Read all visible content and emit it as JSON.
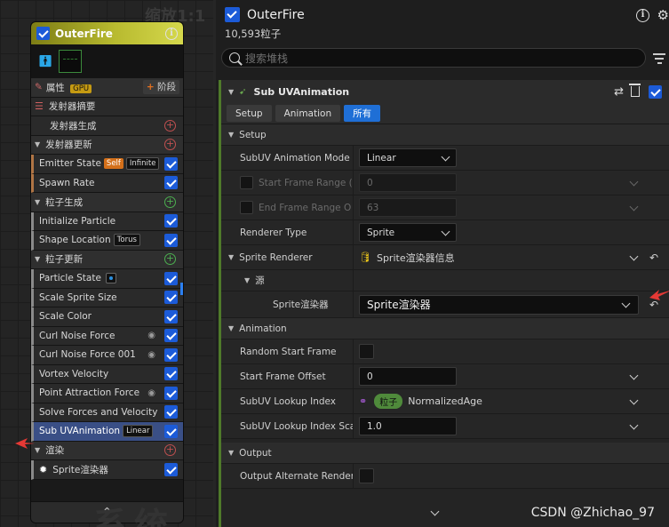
{
  "graph": {
    "zoom_label": "缩放1:1",
    "watermark": "系统"
  },
  "node": {
    "title": "OuterFire",
    "props_label": "属性",
    "gpu_tag": "GPU",
    "stage_label": "阶段",
    "rows": [
      {
        "kind": "plain",
        "label": "发射器摘要",
        "icon": "list-icon"
      },
      {
        "kind": "plain-indent",
        "label": "发射器生成",
        "plus": "red"
      },
      {
        "kind": "section",
        "label": "发射器更新",
        "plus": "red"
      },
      {
        "kind": "module",
        "label": "Emitter State",
        "tags": [
          "Self",
          "Infinite"
        ],
        "checked": true,
        "border": "orange"
      },
      {
        "kind": "module",
        "label": "Spawn Rate",
        "checked": true,
        "border": "orange"
      },
      {
        "kind": "section",
        "label": "粒子生成",
        "plus": "green"
      },
      {
        "kind": "module",
        "label": "Initialize Particle",
        "checked": true
      },
      {
        "kind": "module",
        "label": "Shape Location",
        "tags": [
          "Torus"
        ],
        "checked": true
      },
      {
        "kind": "section",
        "label": "粒子更新",
        "plus": "green"
      },
      {
        "kind": "module",
        "label": "Particle State",
        "badge": true,
        "checked": true
      },
      {
        "kind": "module",
        "label": "Scale Sprite Size",
        "checked": true
      },
      {
        "kind": "module",
        "label": "Scale Color",
        "checked": true
      },
      {
        "kind": "module",
        "label": "Curl Noise Force",
        "eye": true,
        "checked": true
      },
      {
        "kind": "module",
        "label": "Curl Noise Force 001",
        "eye": true,
        "checked": true
      },
      {
        "kind": "module",
        "label": "Vortex Velocity",
        "checked": true
      },
      {
        "kind": "module",
        "label": "Point Attraction Force",
        "eye": true,
        "checked": true
      },
      {
        "kind": "module",
        "label": "Solve Forces and Velocity",
        "checked": true
      },
      {
        "kind": "module-selected",
        "label": "Sub UVAnimation",
        "tags": [
          "Linear"
        ],
        "checked": true
      },
      {
        "kind": "section",
        "label": "渲染",
        "plus": "red"
      },
      {
        "kind": "module",
        "label": "Sprite渲染器",
        "icon": "sprite-burst-icon",
        "checked": true
      }
    ],
    "footer_glyph": "⌃"
  },
  "panel": {
    "emitter_title": "OuterFire",
    "particle_count": "10,593粒子",
    "search_placeholder": "搜索堆栈",
    "module_title": "Sub UVAnimation",
    "tabs": [
      "Setup",
      "Animation",
      "所有"
    ],
    "active_tab": "所有",
    "categories": {
      "setup": "Setup",
      "animation": "Animation",
      "output": "Output"
    },
    "setup": {
      "subuv_mode_label": "SubUV Animation Mode",
      "subuv_mode_value": "Linear",
      "start_frame_label": "Start Frame Range (",
      "start_frame_value": "0",
      "end_frame_label": "End Frame Range O",
      "end_frame_value": "63",
      "renderer_type_label": "Renderer Type",
      "renderer_type_value": "Sprite",
      "sprite_renderer_label": "Sprite Renderer",
      "sprite_renderer_value": "Sprite渲染器信息",
      "source_label": "源",
      "sprite_sub_label": "Sprite渲染器",
      "sprite_sub_value": "Sprite渲染器"
    },
    "animation": {
      "random_start_label": "Random Start Frame",
      "start_offset_label": "Start Frame Offset",
      "start_offset_value": "0",
      "lookup_label": "SubUV Lookup Index",
      "lookup_pill": "粒子",
      "lookup_value": "NormalizedAge",
      "lookup_scale_label": "SubUV Lookup Index Sca",
      "lookup_scale_value": "1.0"
    },
    "output": {
      "alt_render_label": "Output Alternate Render"
    }
  },
  "watermark_csdn": "CSDN @Zhichao_97",
  "colors": {
    "accent_blue": "#1f6fd6",
    "node_header_yellow": "#b8ba2f",
    "annotation_red": "#e53935",
    "module_green": "#4f7a2a"
  }
}
